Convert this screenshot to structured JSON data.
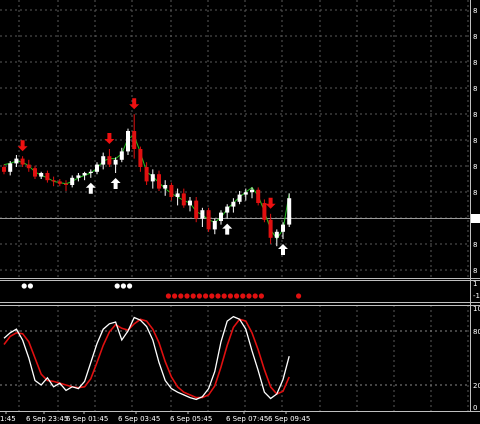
{
  "colors": {
    "background": "#000000",
    "grid": "#5a5a5a",
    "frame": "#bfbfbf",
    "bull": "#ffffff",
    "bear": "#e01010",
    "ma_line": "#22c21e",
    "stoch_main": "#ffffff",
    "stoch_signal": "#e01010",
    "sell_arrow": "#ee1010",
    "buy_arrow": "#ffffff"
  },
  "price_axis": {
    "labels": [
      "8",
      "8",
      "8",
      "8",
      "8",
      "8",
      "8",
      "8",
      "8",
      "8",
      "8"
    ],
    "current_price_label": "8"
  },
  "dots_panel": {
    "axis_labels": [
      "1",
      "-1"
    ]
  },
  "stochastic_panel": {
    "axis_labels": [
      "100",
      "80",
      "20",
      "0"
    ]
  },
  "time_axis": {
    "labels": [
      "1:45",
      "6 Sep 23:45",
      "6 Sep 01:45",
      "6 Sep 03:45",
      "6 Sep 05:45",
      "6 Sep 07:45",
      "6 Sep 09:45"
    ]
  },
  "chart_data": {
    "type": "candlestick",
    "candles": [
      [
        0.4,
        0.42,
        0.34,
        0.36
      ],
      [
        0.36,
        0.45,
        0.33,
        0.43
      ],
      [
        0.43,
        0.5,
        0.4,
        0.47
      ],
      [
        0.47,
        0.49,
        0.4,
        0.42
      ],
      [
        0.42,
        0.46,
        0.36,
        0.39
      ],
      [
        0.39,
        0.41,
        0.3,
        0.32
      ],
      [
        0.32,
        0.36,
        0.3,
        0.35
      ],
      [
        0.35,
        0.37,
        0.27,
        0.29
      ],
      [
        0.29,
        0.32,
        0.24,
        0.28
      ],
      [
        0.28,
        0.3,
        0.24,
        0.26
      ],
      [
        0.26,
        0.29,
        0.2,
        0.25
      ],
      [
        0.25,
        0.33,
        0.23,
        0.31
      ],
      [
        0.31,
        0.35,
        0.28,
        0.33
      ],
      [
        0.33,
        0.36,
        0.29,
        0.35
      ],
      [
        0.35,
        0.38,
        0.31,
        0.36
      ],
      [
        0.36,
        0.44,
        0.34,
        0.42
      ],
      [
        0.42,
        0.52,
        0.38,
        0.49
      ],
      [
        0.49,
        0.55,
        0.4,
        0.42
      ],
      [
        0.42,
        0.48,
        0.35,
        0.46
      ],
      [
        0.46,
        0.56,
        0.44,
        0.53
      ],
      [
        0.53,
        0.72,
        0.5,
        0.7
      ],
      [
        0.7,
        0.84,
        0.47,
        0.55
      ],
      [
        0.55,
        0.57,
        0.36,
        0.4
      ],
      [
        0.4,
        0.44,
        0.25,
        0.28
      ],
      [
        0.28,
        0.38,
        0.22,
        0.34
      ],
      [
        0.34,
        0.37,
        0.2,
        0.22
      ],
      [
        0.22,
        0.29,
        0.16,
        0.25
      ],
      [
        0.25,
        0.27,
        0.12,
        0.15
      ],
      [
        0.15,
        0.22,
        0.08,
        0.18
      ],
      [
        0.18,
        0.22,
        0.06,
        0.08
      ],
      [
        0.08,
        0.15,
        0.03,
        0.12
      ],
      [
        0.12,
        0.15,
        -0.06,
        -0.03
      ],
      [
        -0.03,
        0.06,
        -0.1,
        0.04
      ],
      [
        0.04,
        0.06,
        -0.14,
        -0.12
      ],
      [
        -0.12,
        -0.03,
        -0.16,
        -0.05
      ],
      [
        -0.05,
        0.04,
        -0.08,
        0.02
      ],
      [
        0.02,
        0.09,
        -0.03,
        0.07
      ],
      [
        0.07,
        0.14,
        0.02,
        0.11
      ],
      [
        0.11,
        0.2,
        0.09,
        0.17
      ],
      [
        0.17,
        0.22,
        0.12,
        0.19
      ],
      [
        0.19,
        0.23,
        0.14,
        0.21
      ],
      [
        0.21,
        0.23,
        0.08,
        0.1
      ],
      [
        0.1,
        0.13,
        -0.06,
        -0.04
      ],
      [
        -0.04,
        0.01,
        -0.24,
        -0.19
      ],
      [
        -0.19,
        -0.12,
        -0.26,
        -0.14
      ],
      [
        -0.14,
        -0.06,
        -0.2,
        -0.08
      ],
      [
        -0.08,
        0.18,
        -0.1,
        0.14
      ]
    ],
    "ma_line": [
      0.42,
      0.43,
      0.45,
      0.44,
      0.41,
      0.36,
      0.33,
      0.31,
      0.28,
      0.27,
      0.26,
      0.28,
      0.31,
      0.33,
      0.35,
      0.39,
      0.45,
      0.47,
      0.47,
      0.51,
      0.64,
      0.66,
      0.52,
      0.36,
      0.32,
      0.27,
      0.22,
      0.18,
      0.15,
      0.12,
      0.1,
      0.03,
      0.0,
      -0.04,
      -0.06,
      -0.02,
      0.05,
      0.1,
      0.15,
      0.19,
      0.23,
      0.16,
      0.03,
      -0.12,
      -0.2,
      -0.12,
      0.18
    ],
    "sell_signals": [
      3,
      17,
      21,
      43
    ],
    "buy_signals": [
      14,
      18,
      36,
      45
    ],
    "dots_white": [
      1,
      2,
      16,
      17,
      18
    ],
    "dots_red": [
      22,
      23,
      24,
      25,
      26,
      27,
      28,
      29,
      30,
      31,
      32,
      33,
      34,
      35,
      36,
      37,
      43
    ],
    "stochastic_main": [
      72,
      78,
      82,
      70,
      50,
      25,
      20,
      28,
      18,
      22,
      14,
      18,
      16,
      24,
      45,
      66,
      82,
      88,
      90,
      70,
      80,
      95,
      92,
      85,
      70,
      45,
      25,
      16,
      12,
      9,
      6,
      4,
      7,
      16,
      35,
      68,
      91,
      96,
      93,
      82,
      58,
      36,
      12,
      5,
      10,
      26,
      52
    ],
    "stochastic_signal": [
      65,
      74,
      78,
      77,
      68,
      50,
      32,
      25,
      24,
      22,
      20,
      18,
      17,
      18,
      27,
      45,
      64,
      79,
      87,
      83,
      81,
      88,
      93,
      91,
      82,
      67,
      46,
      29,
      18,
      12,
      9,
      6,
      6,
      9,
      19,
      40,
      64,
      84,
      93,
      91,
      78,
      59,
      37,
      18,
      10,
      13,
      29
    ],
    "stochastic_levels": [
      20,
      80
    ],
    "stochastic_range": [
      0,
      100
    ]
  }
}
